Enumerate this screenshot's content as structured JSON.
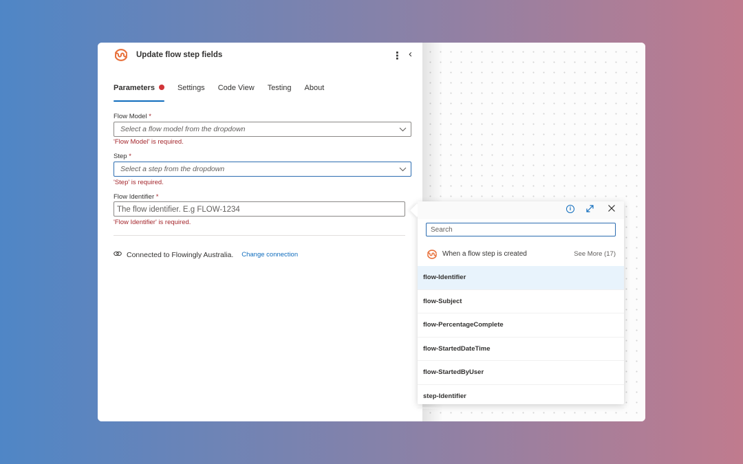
{
  "panel": {
    "title": "Update flow step fields",
    "more_icon": "⋮",
    "collapse_icon": "‹",
    "tabs": [
      {
        "label": "Parameters",
        "active": true,
        "has_error": true
      },
      {
        "label": "Settings",
        "active": false
      },
      {
        "label": "Code View",
        "active": false
      },
      {
        "label": "Testing",
        "active": false
      },
      {
        "label": "About",
        "active": false
      }
    ],
    "fields": {
      "flow_model": {
        "label": "Flow Model",
        "required_mark": "*",
        "placeholder": "Select a flow model from the dropdown",
        "error": "'Flow Model' is required."
      },
      "step": {
        "label": "Step",
        "required_mark": "*",
        "placeholder": "Select a step from the dropdown",
        "error": "'Step' is required."
      },
      "flow_identifier": {
        "label": "Flow Identifier",
        "required_mark": "*",
        "placeholder": "The flow identifier. E.g FLOW-1234",
        "error": "'Flow Identifier' is required."
      }
    },
    "connection": {
      "text": "Connected to Flowingly Australia.",
      "change_label": "Change connection"
    }
  },
  "dynamic_content": {
    "info_icon": "i",
    "expand_icon": "⤢",
    "close_icon": "✕",
    "search_placeholder": "Search",
    "trigger_label": "When a flow step is created",
    "see_more_label": "See More (17)",
    "tokens": [
      {
        "label": "flow-Identifier",
        "highlighted": true
      },
      {
        "label": "flow-Subject"
      },
      {
        "label": "flow-PercentageComplete"
      },
      {
        "label": "flow-StartedDateTime"
      },
      {
        "label": "flow-StartedByUser"
      },
      {
        "label": "step-Identifier"
      }
    ]
  },
  "colors": {
    "brand_orange": "#e8713c",
    "accent_blue": "#0f6cbd",
    "error_red": "#a4262c"
  }
}
